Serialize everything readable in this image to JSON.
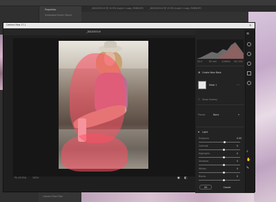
{
  "photoshop": {
    "tabs": [
      "_DSC0453.tif @ 15.9% (Layer 1 copy, RGB/16*)",
      "_DSC0453.tif @ 15.9% (Layer 1 copy, RGB/16*)"
    ],
    "properties_label": "Properties",
    "embedded_label": "Embedded Smart Object",
    "layers": [
      "Convert to Smart Object",
      "Camera Raw Filter"
    ]
  },
  "camera_raw": {
    "title": "Camera Raw 17.1",
    "filename": "_DSC0453.tif",
    "zoom_level": "Fit (15.9%)",
    "zoom_percent": "100%",
    "histogram_info": [
      "f/2.0",
      "85 mm",
      "1/1600s",
      "ISO 100"
    ],
    "create_mask_label": "Create New Mask",
    "mask_name": "Mask 1",
    "show_overlay_label": "Show Overlay",
    "preset_label": "Preset",
    "preset_value": "None",
    "light_section": "Light",
    "sliders": [
      {
        "label": "Exposure",
        "value": "0.00",
        "pos": 0.62
      },
      {
        "label": "Contrast",
        "value": "0",
        "pos": 0.6
      },
      {
        "label": "Highlights",
        "value": "0",
        "pos": 0.6
      },
      {
        "label": "Shadows",
        "value": "0",
        "pos": 0.6
      },
      {
        "label": "Whites",
        "value": "0",
        "pos": 0.6
      },
      {
        "label": "Blacks",
        "value": "0",
        "pos": 0.6
      }
    ],
    "ok_label": "OK",
    "cancel_label": "Cancel"
  }
}
